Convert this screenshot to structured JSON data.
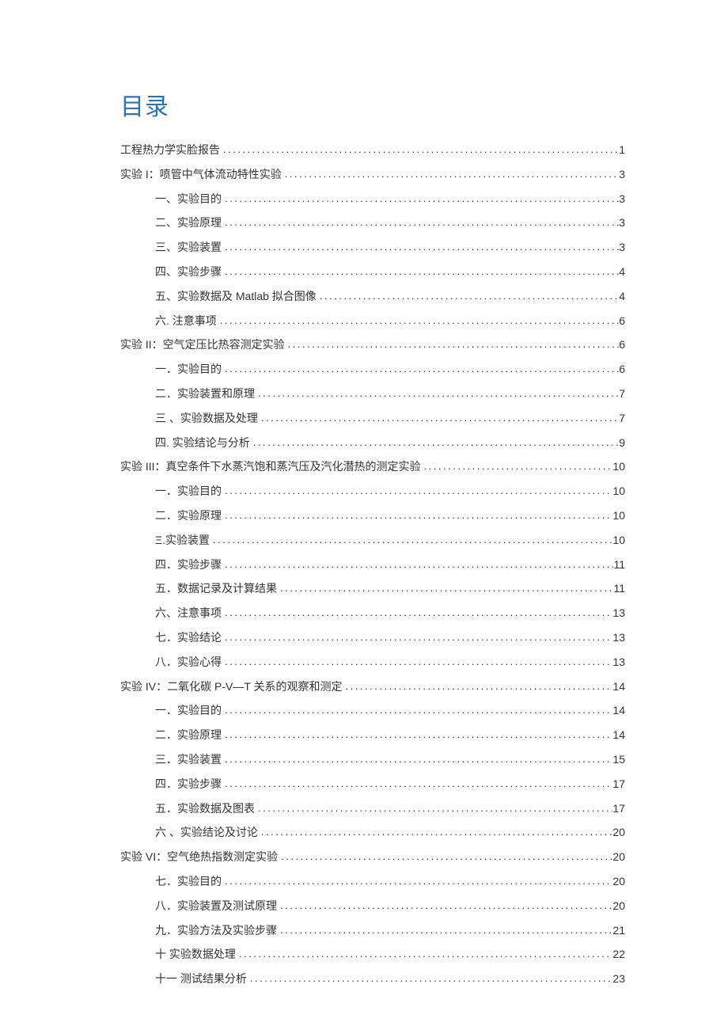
{
  "title": "目录",
  "toc": [
    {
      "level": 1,
      "label": "工程热力学实脸报告",
      "page": "1"
    },
    {
      "level": 1,
      "label": "实验 I：喷管中气体流动特性实验",
      "page": "3"
    },
    {
      "level": 2,
      "label": "一、实验目的",
      "page": "3"
    },
    {
      "level": 2,
      "label": "二、实验原理",
      "page": "3"
    },
    {
      "level": 2,
      "label": "三、实验装置",
      "page": "3"
    },
    {
      "level": 2,
      "label": "四、实验步骤",
      "page": "4"
    },
    {
      "level": 2,
      "label": "五、实验数据及 Matlab 拟合图像",
      "page": "4"
    },
    {
      "level": 2,
      "label": "六. 注意事项",
      "page": "6"
    },
    {
      "level": 1,
      "label": "实验 II：空气定压比热容测定实验",
      "page": "6"
    },
    {
      "level": 2,
      "prefix": "一",
      "label": "．实验目的",
      "page": "6"
    },
    {
      "level": 2,
      "prefix": "二",
      "label": "．实验装置和原理",
      "page": "7"
    },
    {
      "level": 2,
      "prefix": "三",
      "label": "  、实验数据及处理",
      "page": "7"
    },
    {
      "level": 2,
      "label": "四. 实验结论与分析",
      "page": "9"
    },
    {
      "level": 1,
      "label": "实验 III：真空条件下水蒸汽饱和蒸汽压及汽化潜热的测定实验",
      "page": "10"
    },
    {
      "level": 2,
      "prefix": "一",
      "label": "．实验目的",
      "page": "10"
    },
    {
      "level": 2,
      "prefix": "二",
      "label": "．实验原理",
      "page": "10"
    },
    {
      "level": 2,
      "label": "Ξ.实验装置",
      "page": "10"
    },
    {
      "level": 2,
      "prefix": "四",
      "label": "．实验步骤",
      "page": "11"
    },
    {
      "level": 2,
      "prefix": "五",
      "label": "．数据记录及计算结果",
      "page": "11"
    },
    {
      "level": 2,
      "label": "六、注意事项",
      "page": "13"
    },
    {
      "level": 2,
      "prefix": "七",
      "label": "．实验结论",
      "page": "13"
    },
    {
      "level": 2,
      "prefix": "八",
      "label": "．实验心得",
      "page": "13"
    },
    {
      "level": 1,
      "label": "实验 IV：二氧化碳 P-V—T 关系的观察和测定",
      "page": "14"
    },
    {
      "level": 2,
      "prefix": "一",
      "label": "．实验目的",
      "page": "14"
    },
    {
      "level": 2,
      "prefix": "二",
      "label": "．实验原理",
      "page": "14"
    },
    {
      "level": 2,
      "prefix": "三",
      "label": "．实验装置",
      "page": "15"
    },
    {
      "level": 2,
      "prefix": "四",
      "label": "．实验步骤",
      "page": "17"
    },
    {
      "level": 2,
      "prefix": "五",
      "label": "．实验数据及图表",
      "page": "17"
    },
    {
      "level": 2,
      "prefix": "六",
      "label": "  、实验结论及讨论",
      "page": "20"
    },
    {
      "level": 1,
      "label": "实验 VI：空气绝热指数测定实验",
      "page": "20"
    },
    {
      "level": 2,
      "prefix": "七",
      "label": "．实验目的",
      "page": "20"
    },
    {
      "level": 2,
      "prefix": "八",
      "label": "．实验装置及测试原理",
      "page": "20"
    },
    {
      "level": 2,
      "prefix": "九",
      "label": "．实验方法及实验步骤",
      "page": "21"
    },
    {
      "level": 2,
      "prefix": "十",
      "label": "    实验数据处理",
      "page": "22"
    },
    {
      "level": 2,
      "prefix": "十一",
      "label": "  测试结果分析",
      "page": "23"
    }
  ]
}
